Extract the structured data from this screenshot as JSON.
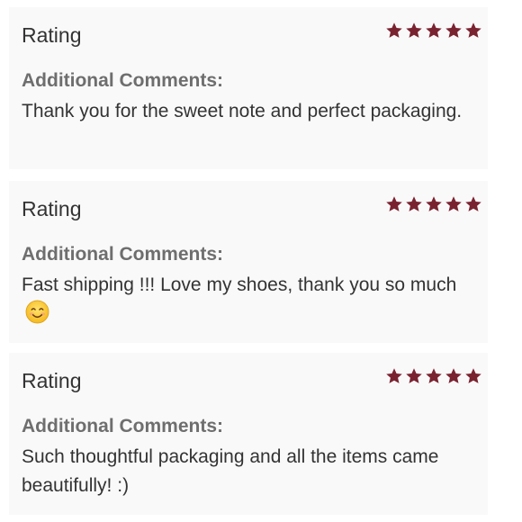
{
  "reviews": [
    {
      "rating_label": "Rating",
      "stars": 5,
      "comments_label": "Additional Comments:",
      "comment": "Thank you for the sweet note and perfect packaging."
    },
    {
      "rating_label": "Rating",
      "stars": 5,
      "comments_label": "Additional Comments:",
      "comment": "Fast shipping !!! Love my shoes, thank you so much",
      "emoji": "smiling-face-icon"
    },
    {
      "rating_label": "Rating",
      "stars": 5,
      "comments_label": "Additional Comments:",
      "comment": "Such thoughtful packaging and all the items came beautifully! :)"
    }
  ],
  "colors": {
    "star": "#7a2330",
    "card_background": "#faf9fa",
    "label_gray": "#6e6e6e",
    "text": "#333333"
  }
}
